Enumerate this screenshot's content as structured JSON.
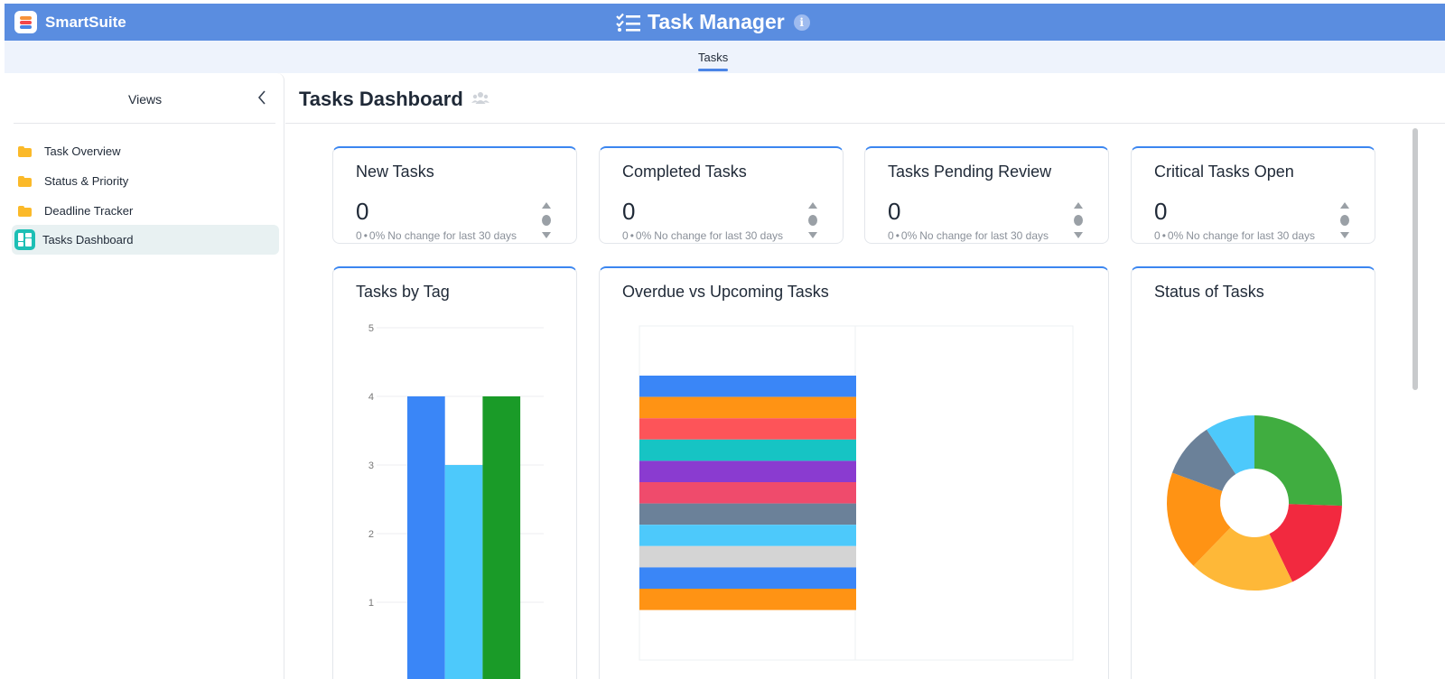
{
  "brand": {
    "name": "SmartSuite"
  },
  "app": {
    "title": "Task Manager",
    "info_icon": "info-icon",
    "title_icon": "checklist-icon"
  },
  "tabs": [
    {
      "label": "Tasks",
      "active": true
    }
  ],
  "sidebar": {
    "title": "Views",
    "items": [
      {
        "label": "Task Overview",
        "icon": "folder-icon",
        "active": false
      },
      {
        "label": "Status & Priority",
        "icon": "folder-icon",
        "active": false
      },
      {
        "label": "Deadline Tracker",
        "icon": "folder-icon",
        "active": false
      },
      {
        "label": "Tasks Dashboard",
        "icon": "dashboard-icon",
        "active": true
      }
    ]
  },
  "page": {
    "title": "Tasks Dashboard"
  },
  "metrics": [
    {
      "title": "New Tasks",
      "value": "0",
      "delta": "0",
      "pct": "0%",
      "note": "No change for last 30 days"
    },
    {
      "title": "Completed Tasks",
      "value": "0",
      "delta": "0",
      "pct": "0%",
      "note": "No change for last 30 days"
    },
    {
      "title": "Tasks Pending Review",
      "value": "0",
      "delta": "0",
      "pct": "0%",
      "note": "No change for last 30 days"
    },
    {
      "title": "Critical Tasks Open",
      "value": "0",
      "delta": "0",
      "pct": "0%",
      "note": "No change for last 30 days"
    }
  ],
  "colors": {
    "accent": "#3b86f0",
    "header": "#5a8de0",
    "tabbar": "#eef3fc"
  },
  "chart_data": [
    {
      "type": "bar",
      "title": "Tasks by Tag",
      "ylim": [
        0,
        5
      ],
      "yticks": [
        "1",
        "2",
        "3",
        "4",
        "5"
      ],
      "grid": true,
      "series": [
        {
          "values": [
            4
          ],
          "color": "#3a86f7"
        },
        {
          "values": [
            3
          ],
          "color": "#4dc9fb"
        },
        {
          "values": [
            4
          ],
          "color": "#1a9b28"
        }
      ]
    },
    {
      "type": "bar",
      "title": "Overdue vs Upcoming Tasks",
      "orientation": "horizontal",
      "stacked": true,
      "segments": [
        {
          "value": 1,
          "color": "#3a86f7"
        },
        {
          "value": 1,
          "color": "#ff9314"
        },
        {
          "value": 1,
          "color": "#fd5459"
        },
        {
          "value": 1,
          "color": "#16c4c4"
        },
        {
          "value": 1,
          "color": "#8a3bd0"
        },
        {
          "value": 1,
          "color": "#ef4b6c"
        },
        {
          "value": 1,
          "color": "#6b8199"
        },
        {
          "value": 1,
          "color": "#4dc9fb"
        },
        {
          "value": 1,
          "color": "#d4d4d4"
        },
        {
          "value": 1,
          "color": "#3a86f7"
        },
        {
          "value": 1,
          "color": "#ff9314"
        }
      ]
    },
    {
      "type": "pie",
      "title": "Status of Tasks",
      "donut": true,
      "slices": [
        {
          "value": 25,
          "color": "#40ad40"
        },
        {
          "value": 17,
          "color": "#f2293f"
        },
        {
          "value": 19,
          "color": "#feb838"
        },
        {
          "value": 18,
          "color": "#ff9314"
        },
        {
          "value": 10,
          "color": "#6b8199"
        },
        {
          "value": 9,
          "color": "#4dc9fb"
        }
      ]
    }
  ]
}
